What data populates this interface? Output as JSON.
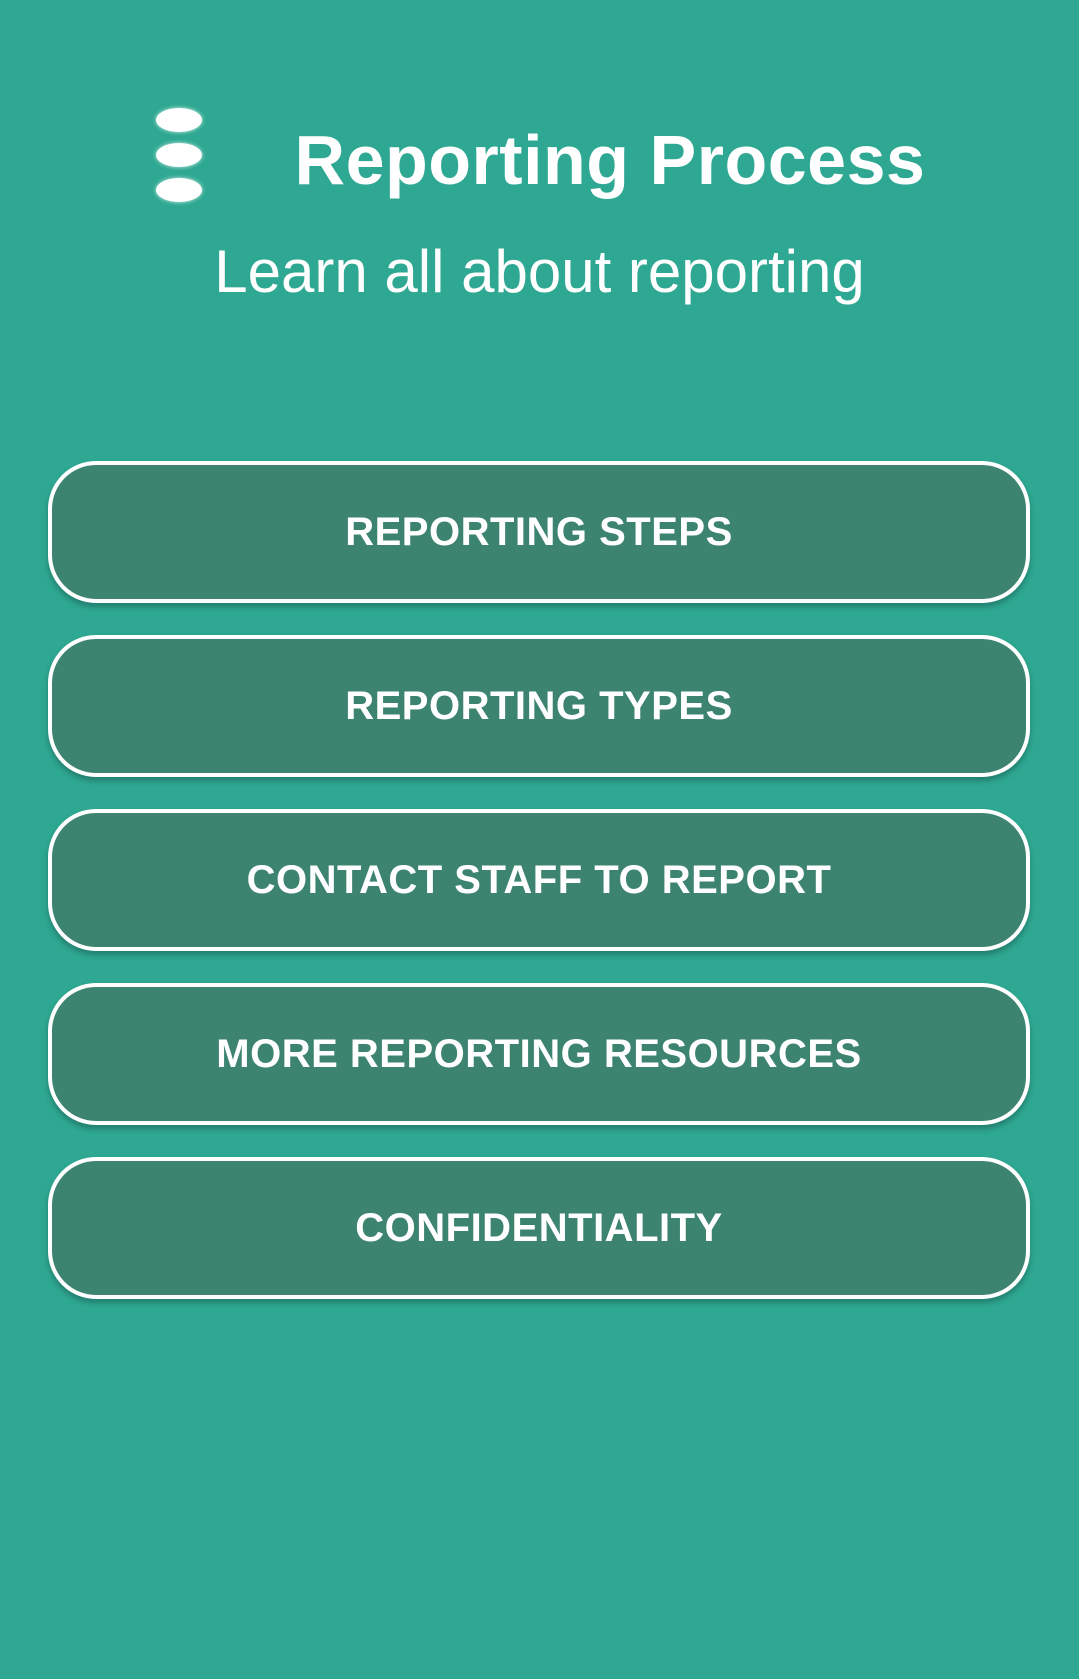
{
  "header": {
    "menu_icon": "more-vertical-icon",
    "title": "Reporting Process",
    "subtitle": "Learn all about reporting"
  },
  "menu": {
    "items": [
      {
        "label": "REPORTING STEPS"
      },
      {
        "label": "REPORTING TYPES"
      },
      {
        "label": "CONTACT STAFF TO REPORT"
      },
      {
        "label": "MORE REPORTING RESOURCES"
      },
      {
        "label": "CONFIDENTIALITY"
      }
    ]
  },
  "colors": {
    "background": "#2ea892",
    "button_fill": "#3c8370",
    "button_border": "#ffffff",
    "text": "#ffffff"
  }
}
